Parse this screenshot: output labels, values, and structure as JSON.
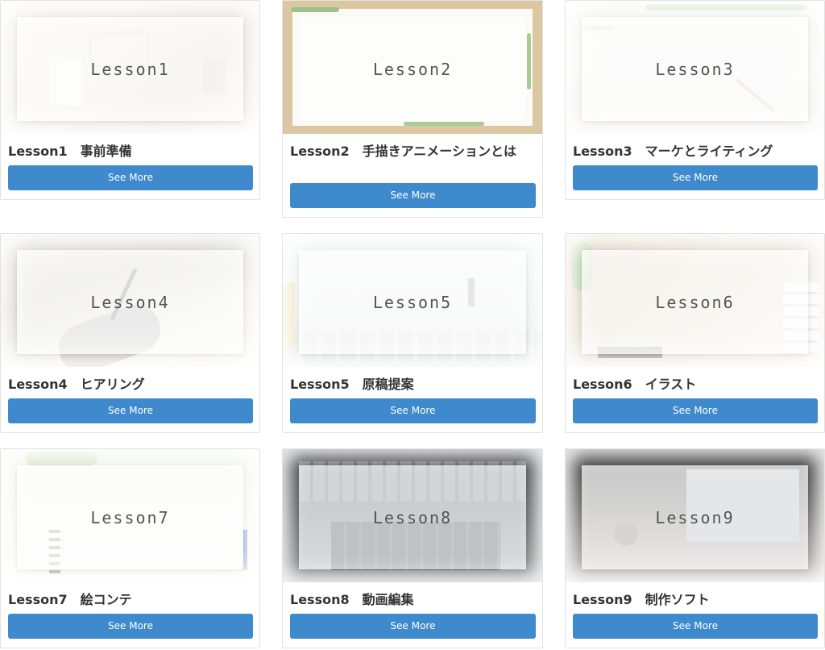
{
  "accent_color": "#3e8acc",
  "lessons": [
    {
      "thumb_label": "Lesson1",
      "title": "Lesson1　事前準備",
      "button_label": "See More"
    },
    {
      "thumb_label": "Lesson2",
      "title": "Lesson2　手描きアニメーションとは",
      "button_label": "See More"
    },
    {
      "thumb_label": "Lesson3",
      "title": "Lesson3　マーケとライティング",
      "button_label": "See More"
    },
    {
      "thumb_label": "Lesson4",
      "title": "Lesson4　ヒアリング",
      "button_label": "See More"
    },
    {
      "thumb_label": "Lesson5",
      "title": "Lesson5　原稿提案",
      "button_label": "See More"
    },
    {
      "thumb_label": "Lesson6",
      "title": "Lesson6　イラスト",
      "button_label": "See More"
    },
    {
      "thumb_label": "Lesson7",
      "title": "Lesson7　絵コンテ",
      "button_label": "See More"
    },
    {
      "thumb_label": "Lesson8",
      "title": "Lesson8　動画編集",
      "button_label": "See More"
    },
    {
      "thumb_label": "Lesson9",
      "title": "Lesson9　制作ソフト",
      "button_label": "See More"
    }
  ]
}
